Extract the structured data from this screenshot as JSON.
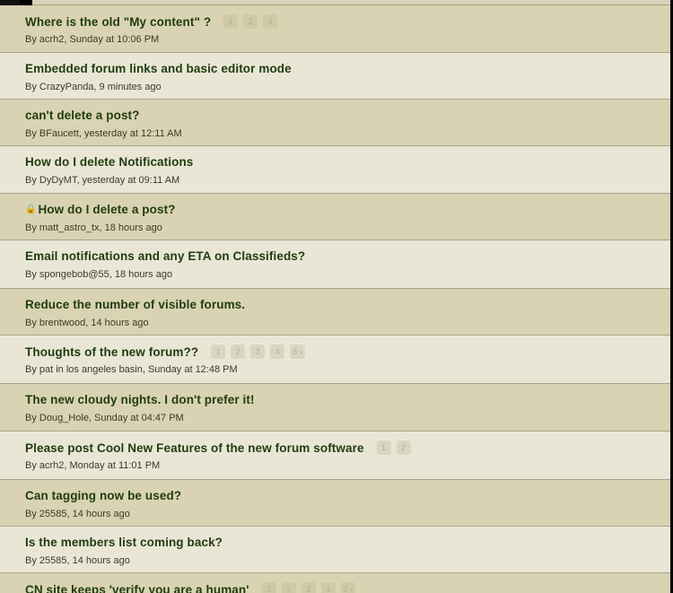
{
  "threads": [
    {
      "title": "Where is the old \"My content\" ?",
      "meta": "By acrh2, Sunday at 10:06 PM",
      "pages": [
        "1",
        "2",
        "3"
      ],
      "locked": false
    },
    {
      "title": "Embedded forum links and basic editor mode",
      "meta": "By CrazyPanda, 9 minutes ago",
      "pages": [],
      "locked": false
    },
    {
      "title": "can't delete a post?",
      "meta": "By BFaucett, yesterday at 12:11 AM",
      "pages": [],
      "locked": false
    },
    {
      "title": "How do I delete Notifications",
      "meta": "By DyDyMT, yesterday at 09:11 AM",
      "pages": [],
      "locked": false
    },
    {
      "title": "How do I delete a post?",
      "meta": "By matt_astro_tx, 18 hours ago",
      "pages": [],
      "locked": true
    },
    {
      "title": "Email notifications and any ETA on Classifieds?",
      "meta": "By spongebob@55, 18 hours ago",
      "pages": [],
      "locked": false
    },
    {
      "title": "Reduce the number of visible forums.",
      "meta": "By brentwood, 14 hours ago",
      "pages": [],
      "locked": false
    },
    {
      "title": "Thoughts of the new forum??",
      "meta": "By pat in los angeles basin, Sunday at 12:48 PM",
      "pages": [
        "1",
        "2",
        "3",
        "4",
        "8 ›"
      ],
      "locked": false
    },
    {
      "title": "The new cloudy nights. I don't prefer it!",
      "meta": "By Doug_Hole, Sunday at 04:47 PM",
      "pages": [],
      "locked": false
    },
    {
      "title": "Please post Cool New Features of the new forum software",
      "meta": "By acrh2, Monday at 11:01 PM",
      "pages": [
        "1",
        "2"
      ],
      "locked": false
    },
    {
      "title": "Can tagging now be used?",
      "meta": "By 25585, 14 hours ago",
      "pages": [],
      "locked": false
    },
    {
      "title": "Is the members list coming back?",
      "meta": "By 25585, 14 hours ago",
      "pages": [],
      "locked": false
    },
    {
      "title": "CN site keeps 'verify you are a human'",
      "meta": "",
      "pages": [
        "1",
        "2",
        "3",
        "4",
        "7 ›"
      ],
      "locked": false
    }
  ],
  "icons": {
    "lock": "lock-icon"
  }
}
